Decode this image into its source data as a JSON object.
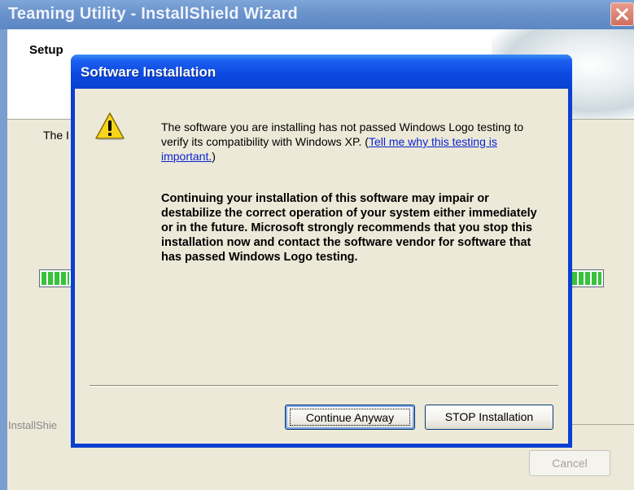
{
  "background_window": {
    "title": "Teaming Utility - InstallShield Wizard",
    "header_title": "Setup",
    "body_text_fragment": "The I",
    "footer_brand": "InstallShie",
    "cancel_label": "Cancel",
    "progress_color": "#38c23a"
  },
  "dialog": {
    "title": "Software Installation",
    "icon": "warning-icon",
    "message_part1": "The software you are installing has not passed Windows Logo testing to verify its compatibility with Windows XP. (",
    "message_link": "Tell me why this testing is important.",
    "message_part2": ")",
    "warning_text": "Continuing your installation of this software may impair or destabilize the correct operation of your system either immediately or in the future. Microsoft strongly recommends that you stop this installation now and contact the software vendor for software that has passed Windows Logo testing.",
    "continue_label": "Continue Anyway",
    "stop_label": "STOP Installation"
  },
  "colors": {
    "title_blue": "#0a48e0",
    "dialog_face": "#ece9d8",
    "link": "#0b24d4"
  }
}
